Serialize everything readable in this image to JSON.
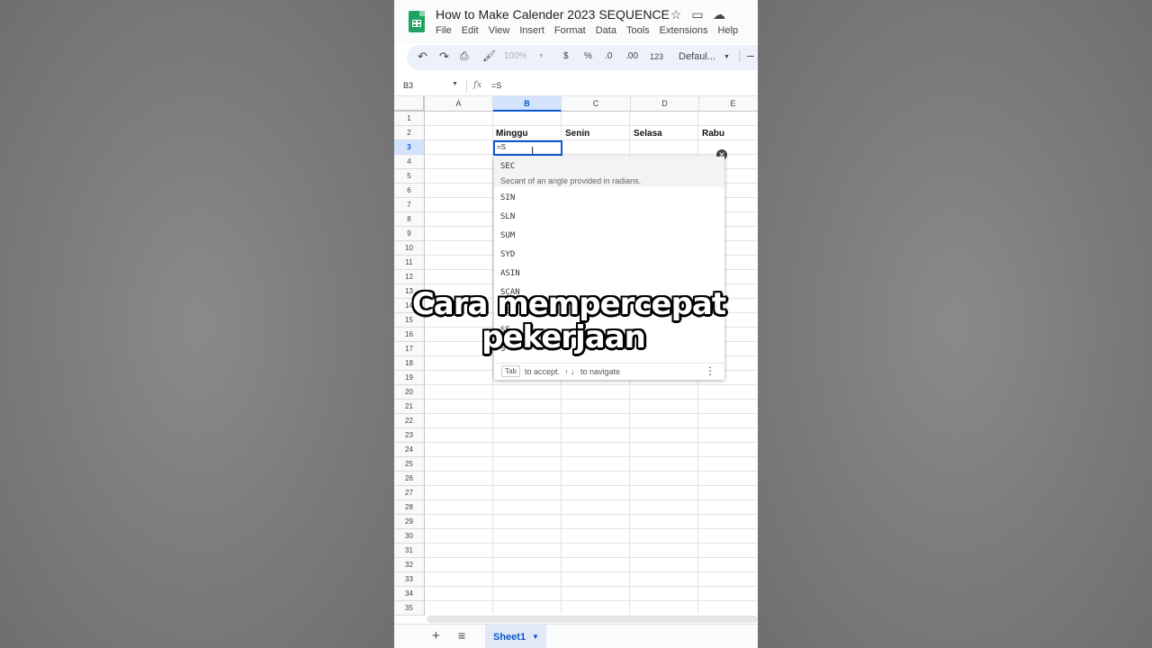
{
  "doc": {
    "title": "How to Make Calender 2023 SEQUENCE",
    "menu": [
      "File",
      "Edit",
      "View",
      "Insert",
      "Format",
      "Data",
      "Tools",
      "Extensions",
      "Help"
    ]
  },
  "toolbar": {
    "zoom": "100%",
    "currency": "$",
    "percent": "%",
    "decrease_decimal": ".0",
    "increase_decimal": ".00",
    "number_format": "123",
    "font": "Defaul..."
  },
  "formula_bar": {
    "cell_ref": "B3",
    "fx": "fx",
    "value": "=S"
  },
  "grid": {
    "columns": [
      "A",
      "B",
      "C",
      "D",
      "E"
    ],
    "rows": [
      "1",
      "2",
      "3",
      "4",
      "5",
      "6",
      "7",
      "8",
      "9",
      "10",
      "11",
      "12",
      "13",
      "14",
      "15",
      "16",
      "17",
      "18",
      "19",
      "20",
      "21",
      "22",
      "23",
      "24",
      "25",
      "26",
      "27",
      "28",
      "29",
      "30",
      "31",
      "32",
      "33",
      "34",
      "35"
    ],
    "cells": {
      "B2": "Minggu",
      "C2": "Senin",
      "D2": "Selasa",
      "E2": "Rabu"
    },
    "active_cell_text": "=S"
  },
  "autocomplete": {
    "first": {
      "name": "SEC",
      "description": "Secant of an angle provided in radians."
    },
    "items": [
      "SIN",
      "SLN",
      "SUM",
      "SYD",
      "ASIN",
      "SCAN",
      "SEC",
      "SE",
      "S"
    ],
    "footer": {
      "key": "Tab",
      "accept": "to accept.",
      "arrows": "↑ ↓",
      "navigate": "to navigate"
    }
  },
  "caption": {
    "line1": "Cara mempercepat",
    "line2": "pekerjaan"
  },
  "sheets": {
    "active": "Sheet1"
  },
  "colors": {
    "accent": "#0b57d0",
    "sheets_green": "#1ea362"
  }
}
